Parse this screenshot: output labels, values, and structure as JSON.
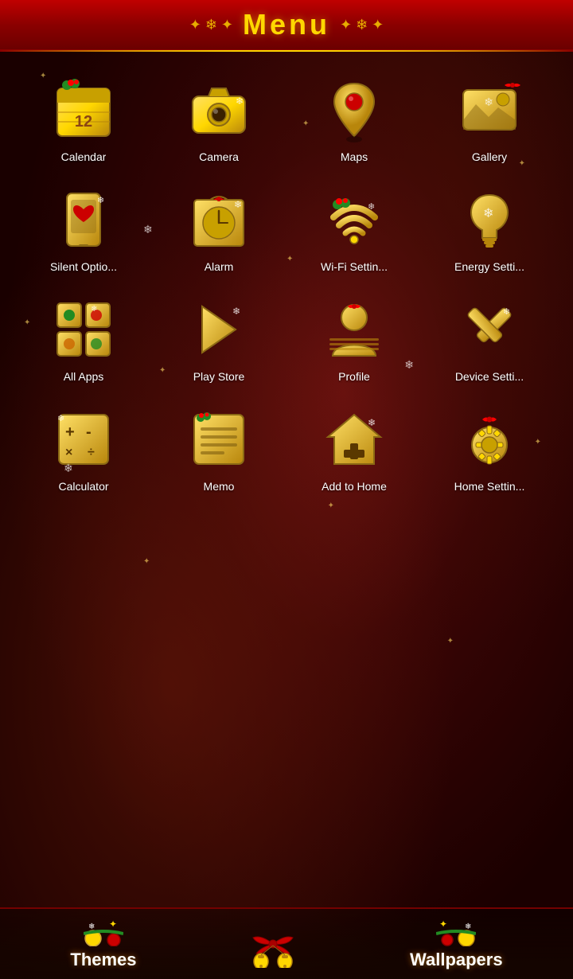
{
  "header": {
    "title": "Menu",
    "decor_left": "✦ ❄ ✦",
    "decor_right": "✦ ❄ ✦"
  },
  "icons": [
    {
      "id": "calendar",
      "label": "Calendar",
      "emoji": "📅"
    },
    {
      "id": "camera",
      "label": "Camera",
      "emoji": "📷"
    },
    {
      "id": "maps",
      "label": "Maps",
      "emoji": "📍"
    },
    {
      "id": "gallery",
      "label": "Gallery",
      "emoji": "🖼"
    },
    {
      "id": "silent",
      "label": "Silent Optio...",
      "emoji": "📱"
    },
    {
      "id": "alarm",
      "label": "Alarm",
      "emoji": "⏰"
    },
    {
      "id": "wifi",
      "label": "Wi-Fi Settin...",
      "emoji": "📶"
    },
    {
      "id": "energy",
      "label": "Energy Setti...",
      "emoji": "💡"
    },
    {
      "id": "allapps",
      "label": "All Apps",
      "emoji": "⊞"
    },
    {
      "id": "playstore",
      "label": "Play Store",
      "emoji": "▶"
    },
    {
      "id": "profile",
      "label": "Profile",
      "emoji": "👤"
    },
    {
      "id": "devicesettings",
      "label": "Device Setti...",
      "emoji": "⚙"
    },
    {
      "id": "calculator",
      "label": "Calculator",
      "emoji": "🧮"
    },
    {
      "id": "memo",
      "label": "Memo",
      "emoji": "📝"
    },
    {
      "id": "addtohome",
      "label": "Add to Home",
      "emoji": "🏠"
    },
    {
      "id": "homesettings",
      "label": "Home Settin...",
      "emoji": "⚙"
    }
  ],
  "bottom": {
    "themes_label": "Themes",
    "wallpapers_label": "Wallpapers"
  },
  "colors": {
    "gold": "#ffd700",
    "gold_dark": "#b8860b",
    "red": "#cc0000",
    "white": "#ffffff"
  }
}
